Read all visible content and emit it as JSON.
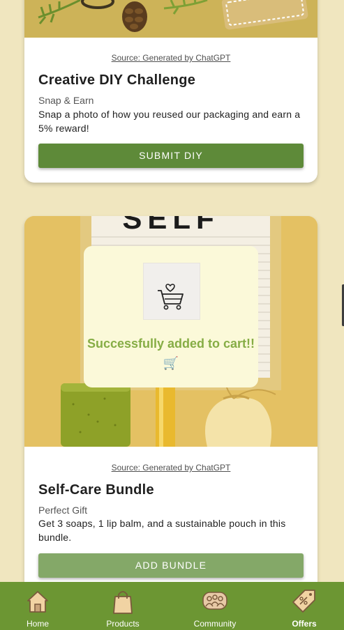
{
  "cards": [
    {
      "source": "Source: Generated by ChatGPT",
      "title": "Creative DIY Challenge",
      "subtitle": "Snap & Earn",
      "description": "Snap a photo of how you reused our packaging and earn a 5% reward!",
      "button": "SUBMIT DIY"
    },
    {
      "image_text": "SELF",
      "source": "Source: Generated by ChatGPT",
      "title": "Self-Care Bundle",
      "subtitle": "Perfect Gift",
      "description": "Get 3 soaps, 1 lip balm, and a sustainable pouch in this bundle.",
      "button": "ADD BUNDLE"
    }
  ],
  "toast": {
    "message": "Successfully added to cart!! 🛒",
    "icon": "cart-heart-icon"
  },
  "nav": {
    "items": [
      {
        "label": "Home",
        "icon": "home-icon"
      },
      {
        "label": "Products",
        "icon": "shopping-bag-icon"
      },
      {
        "label": "Community",
        "icon": "community-icon"
      },
      {
        "label": "Offers",
        "icon": "offers-icon",
        "active": true
      }
    ]
  },
  "colors": {
    "background": "#f0e6bf",
    "button": "#5e8a39",
    "navbar": "#6c9633",
    "toast_text": "#86ad45"
  }
}
